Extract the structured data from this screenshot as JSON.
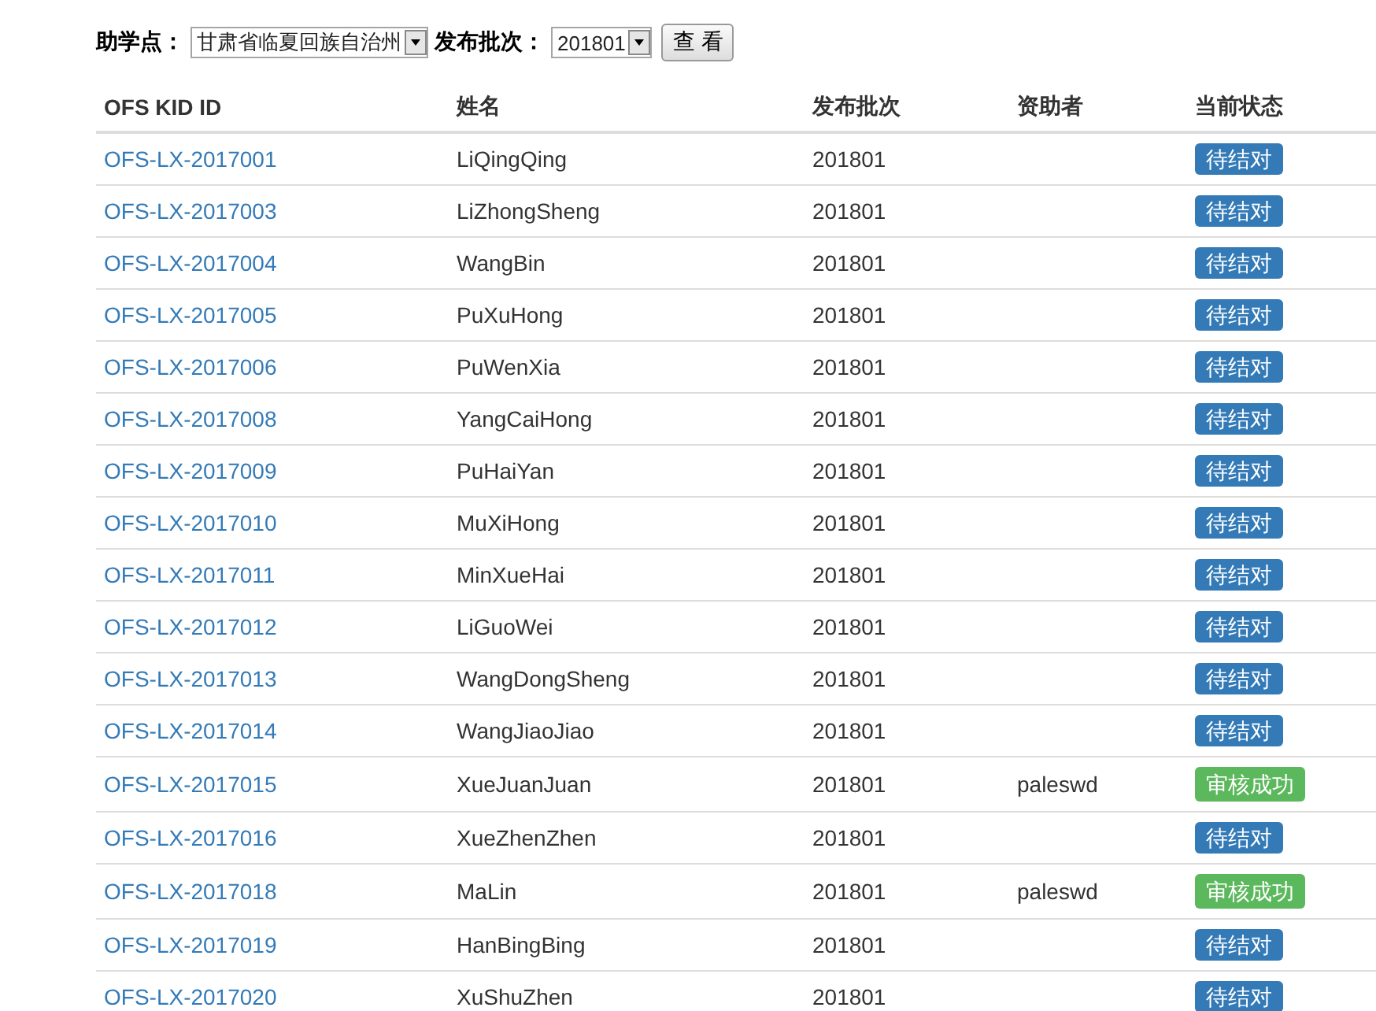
{
  "filter": {
    "site_label": "助学点：",
    "site_value": "甘肃省临夏回族自治州",
    "batch_label": "发布批次：",
    "batch_value": "201801",
    "button": "查 看"
  },
  "table": {
    "columns": [
      "OFS KID ID",
      "姓名",
      "发布批次",
      "资助者",
      "当前状态"
    ],
    "rows": [
      {
        "id": "OFS-LX-2017001",
        "name": "LiQingQing",
        "batch": "201801",
        "sponsor": "",
        "status": {
          "text": "待结对",
          "kind": "pending"
        }
      },
      {
        "id": "OFS-LX-2017003",
        "name": "LiZhongSheng",
        "batch": "201801",
        "sponsor": "",
        "status": {
          "text": "待结对",
          "kind": "pending"
        }
      },
      {
        "id": "OFS-LX-2017004",
        "name": "WangBin",
        "batch": "201801",
        "sponsor": "",
        "status": {
          "text": "待结对",
          "kind": "pending"
        }
      },
      {
        "id": "OFS-LX-2017005",
        "name": "PuXuHong",
        "batch": "201801",
        "sponsor": "",
        "status": {
          "text": "待结对",
          "kind": "pending"
        }
      },
      {
        "id": "OFS-LX-2017006",
        "name": "PuWenXia",
        "batch": "201801",
        "sponsor": "",
        "status": {
          "text": "待结对",
          "kind": "pending"
        }
      },
      {
        "id": "OFS-LX-2017008",
        "name": "YangCaiHong",
        "batch": "201801",
        "sponsor": "",
        "status": {
          "text": "待结对",
          "kind": "pending"
        }
      },
      {
        "id": "OFS-LX-2017009",
        "name": "PuHaiYan",
        "batch": "201801",
        "sponsor": "",
        "status": {
          "text": "待结对",
          "kind": "pending"
        }
      },
      {
        "id": "OFS-LX-2017010",
        "name": "MuXiHong",
        "batch": "201801",
        "sponsor": "",
        "status": {
          "text": "待结对",
          "kind": "pending"
        }
      },
      {
        "id": "OFS-LX-2017011",
        "name": "MinXueHai",
        "batch": "201801",
        "sponsor": "",
        "status": {
          "text": "待结对",
          "kind": "pending"
        }
      },
      {
        "id": "OFS-LX-2017012",
        "name": "LiGuoWei",
        "batch": "201801",
        "sponsor": "",
        "status": {
          "text": "待结对",
          "kind": "pending"
        }
      },
      {
        "id": "OFS-LX-2017013",
        "name": "WangDongSheng",
        "batch": "201801",
        "sponsor": "",
        "status": {
          "text": "待结对",
          "kind": "pending"
        }
      },
      {
        "id": "OFS-LX-2017014",
        "name": "WangJiaoJiao",
        "batch": "201801",
        "sponsor": "",
        "status": {
          "text": "待结对",
          "kind": "pending"
        }
      },
      {
        "id": "OFS-LX-2017015",
        "name": "XueJuanJuan",
        "batch": "201801",
        "sponsor": "paleswd",
        "status": {
          "text": "审核成功",
          "kind": "approved"
        }
      },
      {
        "id": "OFS-LX-2017016",
        "name": "XueZhenZhen",
        "batch": "201801",
        "sponsor": "",
        "status": {
          "text": "待结对",
          "kind": "pending"
        }
      },
      {
        "id": "OFS-LX-2017018",
        "name": "MaLin",
        "batch": "201801",
        "sponsor": "paleswd",
        "status": {
          "text": "审核成功",
          "kind": "approved"
        }
      },
      {
        "id": "OFS-LX-2017019",
        "name": "HanBingBing",
        "batch": "201801",
        "sponsor": "",
        "status": {
          "text": "待结对",
          "kind": "pending"
        }
      },
      {
        "id": "OFS-LX-2017020",
        "name": "XuShuZhen",
        "batch": "201801",
        "sponsor": "",
        "status": {
          "text": "待结对",
          "kind": "pending"
        }
      }
    ]
  }
}
